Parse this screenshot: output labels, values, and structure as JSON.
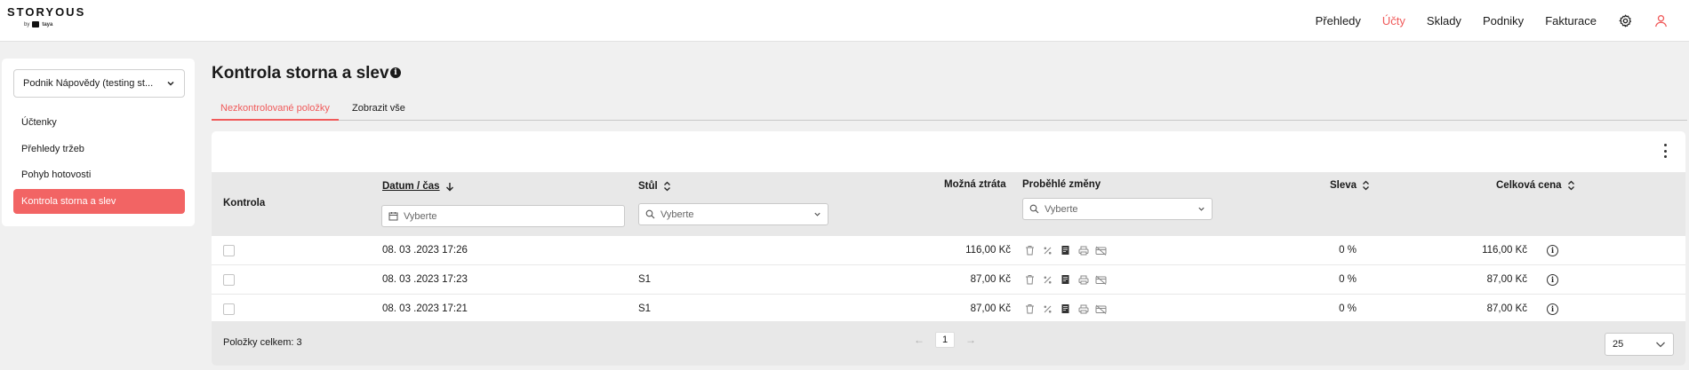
{
  "brand": {
    "name": "STORYOUS",
    "by": "by",
    "partner": "taya"
  },
  "topnav": {
    "items": [
      {
        "label": "Přehledy",
        "active": false
      },
      {
        "label": "Účty",
        "active": true
      },
      {
        "label": "Sklady",
        "active": false
      },
      {
        "label": "Podniky",
        "active": false
      },
      {
        "label": "Fakturace",
        "active": false
      }
    ],
    "icons": [
      "gear-icon",
      "user-icon"
    ]
  },
  "sidebar": {
    "venue": "Podnik Nápovědy (testing st...",
    "items": [
      {
        "label": "Účtenky",
        "active": false
      },
      {
        "label": "Přehledy tržeb",
        "active": false
      },
      {
        "label": "Pohyb hotovosti",
        "active": false
      },
      {
        "label": "Kontrola storna a slev",
        "active": true
      }
    ]
  },
  "page": {
    "title": "Kontrola storna a slev"
  },
  "tabs": [
    {
      "label": "Nezkontrolované položky",
      "active": true
    },
    {
      "label": "Zobrazit vše",
      "active": false
    }
  ],
  "table": {
    "columns": {
      "kontrola": "Kontrola",
      "datum": "Datum / čas",
      "stul": "Stůl",
      "ztrata": "Možná ztráta",
      "zmeny": "Proběhlé změny",
      "sleva": "Sleva",
      "cena": "Celková cena"
    },
    "filter_placeholders": {
      "datum": "Vyberte",
      "stul": "Vyberte",
      "zmeny": "Vyberte"
    },
    "rows": [
      {
        "datum": "08. 03 .2023 17:26",
        "stul": "",
        "ztrata": "116,00 Kč",
        "sleva": "0 %",
        "cena": "116,00 Kč"
      },
      {
        "datum": "08. 03 .2023 17:23",
        "stul": "S1",
        "ztrata": "87,00 Kč",
        "sleva": "0 %",
        "cena": "87,00 Kč"
      },
      {
        "datum": "08. 03 .2023 17:21",
        "stul": "S1",
        "ztrata": "87,00 Kč",
        "sleva": "0 %",
        "cena": "87,00 Kč"
      }
    ],
    "change_icons": [
      "trash-icon",
      "percent-icon",
      "receipt-icon",
      "printer-icon",
      "card-off-icon"
    ]
  },
  "footer": {
    "total": "Položky celkem: 3",
    "page": "1",
    "page_size": "25"
  },
  "colors": {
    "accent": "#f05a5a",
    "sidebar_active": "#f26464"
  }
}
